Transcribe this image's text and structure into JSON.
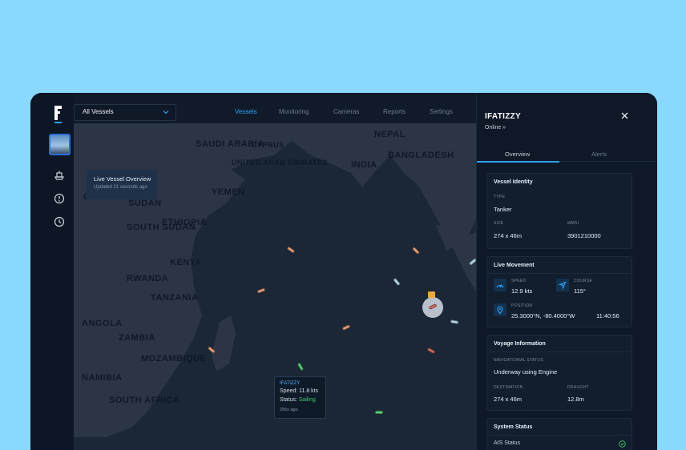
{
  "app": {
    "vessel_select": "All Vessels",
    "nav_tabs": [
      "Vessels",
      "Monitoring",
      "Cameras",
      "Reports",
      "Settings"
    ],
    "active_tab": "Vessels"
  },
  "map": {
    "overlay_title": "Live Vessel Overview",
    "overlay_updated": "Updated 21 seconds ago",
    "region_labels": [
      "Saudi Arabia",
      "Cyprus",
      "United Arab Emirates",
      "Nepal",
      "India",
      "Bangladesh",
      "Chad",
      "Yemen",
      "Sudan",
      "Ethiopia",
      "South Sudan",
      "Kenya",
      "Rwanda",
      "Tanzania",
      "Angola",
      "Zambia",
      "Mozambique",
      "Namibia",
      "South Africa"
    ],
    "tooltip": {
      "name": "IFATIZZY",
      "speed": "Speed: 11.8 kts",
      "status_prefix": "Status: ",
      "status_value": "Sailing",
      "ago": "256s ago"
    }
  },
  "panel": {
    "vessel_name": "IFATIZZY",
    "status": "Online »",
    "tabs": [
      "Overview",
      "Alerts"
    ],
    "identity": {
      "title": "Vessel Identity",
      "type_label": "TYPE",
      "type_value": "Tanker",
      "size_label": "SIZE",
      "size_value": "274 x 46m",
      "mmsi_label": "MMSI",
      "mmsi_value": "3901210000"
    },
    "movement": {
      "title": "Live Movement",
      "speed_label": "SPEED",
      "speed_value": "12.9 kts",
      "course_label": "COURSE",
      "course_value": "115°",
      "position_label": "POSITION",
      "position_value": "25.3000°N, -80.4000°W",
      "time_value": "11:40:56"
    },
    "voyage": {
      "title": "Voyage Information",
      "nav_label": "NAVIGATIONAL STATUS",
      "nav_value": "Underway using Engine",
      "dest_label": "DESTINATION",
      "dest_value": "274 x 46m",
      "draught_label": "DRAUGHT",
      "draught_value": "12.8m"
    },
    "system": {
      "title": "System Status",
      "ais_label": "AIS Status"
    }
  },
  "colors": {
    "accent": "#2fa4ff",
    "sailing": "#46c46d",
    "ship_orange": "#e8a07a",
    "ship_green": "#5fd07a",
    "ship_blue": "#b9dbef",
    "ship_red": "#d96b5e"
  },
  "icons": [
    "ship-icon",
    "alert-icon",
    "clock-icon",
    "chevron-down-icon",
    "close-icon",
    "speed-icon",
    "course-icon",
    "position-icon",
    "check-icon"
  ]
}
